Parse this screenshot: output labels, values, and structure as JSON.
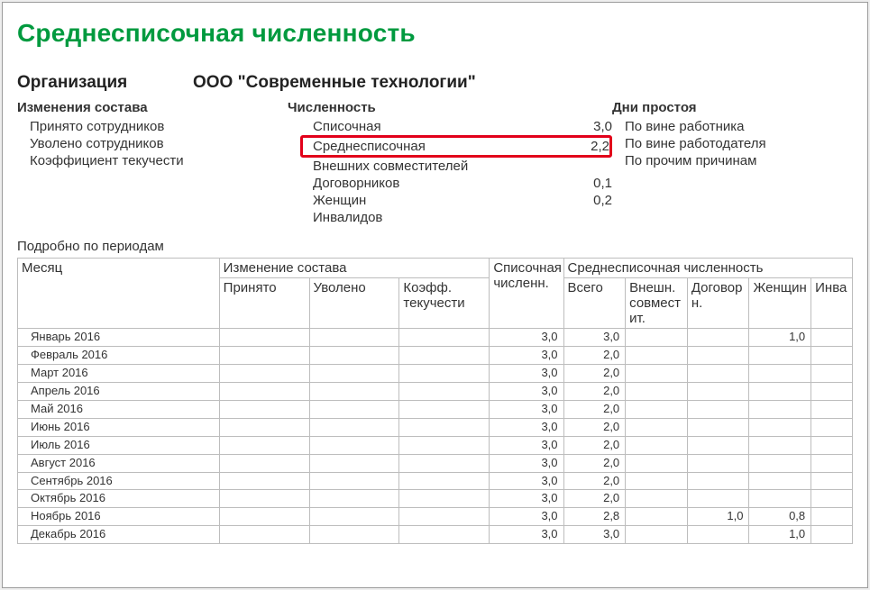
{
  "title": "Среднесписочная численность",
  "org": {
    "label": "Организация",
    "value": "ООО \"Современные технологии\""
  },
  "changes": {
    "header": "Изменения состава",
    "rows": [
      {
        "label": "Принято сотрудников",
        "value": ""
      },
      {
        "label": "Уволено сотрудников",
        "value": ""
      },
      {
        "label": "Коэффициент текучести",
        "value": ""
      }
    ]
  },
  "count": {
    "header": "Численность",
    "rows": [
      {
        "label": "Списочная",
        "value": "3,0",
        "hl": false
      },
      {
        "label": "Среднесписочная",
        "value": "2,2",
        "hl": true
      },
      {
        "label": "Внешних совместителей",
        "value": "",
        "hl": false
      },
      {
        "label": "Договорников",
        "value": "0,1",
        "hl": false
      },
      {
        "label": "Женщин",
        "value": "0,2",
        "hl": false
      },
      {
        "label": "Инвалидов",
        "value": "",
        "hl": false
      }
    ]
  },
  "idle": {
    "header": "Дни простоя",
    "rows": [
      {
        "label": "По вине работника",
        "value": ""
      },
      {
        "label": "По вине работодателя",
        "value": ""
      },
      {
        "label": "По прочим причинам",
        "value": ""
      }
    ]
  },
  "periods_title": "Подробно по периодам",
  "table": {
    "head": {
      "month": "Месяц",
      "changes_group": "Изменение состава",
      "changes": [
        "Принято",
        "Уволено",
        "Коэфф. текучести"
      ],
      "list": "Списочная численн.",
      "avg_group": "Среднесписочная численность",
      "avg": [
        "Всего",
        "Внешн. совмест ит.",
        "Договор н.",
        "Женщин",
        "Инва"
      ]
    },
    "rows": [
      {
        "month": "Январь 2016",
        "hired": "",
        "fired": "",
        "kt": "",
        "list": "3,0",
        "total": "3,0",
        "ext": "",
        "dog": "",
        "women": "1,0",
        "inv": ""
      },
      {
        "month": "Февраль 2016",
        "hired": "",
        "fired": "",
        "kt": "",
        "list": "3,0",
        "total": "2,0",
        "ext": "",
        "dog": "",
        "women": "",
        "inv": ""
      },
      {
        "month": "Март 2016",
        "hired": "",
        "fired": "",
        "kt": "",
        "list": "3,0",
        "total": "2,0",
        "ext": "",
        "dog": "",
        "women": "",
        "inv": ""
      },
      {
        "month": "Апрель 2016",
        "hired": "",
        "fired": "",
        "kt": "",
        "list": "3,0",
        "total": "2,0",
        "ext": "",
        "dog": "",
        "women": "",
        "inv": ""
      },
      {
        "month": "Май 2016",
        "hired": "",
        "fired": "",
        "kt": "",
        "list": "3,0",
        "total": "2,0",
        "ext": "",
        "dog": "",
        "women": "",
        "inv": ""
      },
      {
        "month": "Июнь 2016",
        "hired": "",
        "fired": "",
        "kt": "",
        "list": "3,0",
        "total": "2,0",
        "ext": "",
        "dog": "",
        "women": "",
        "inv": ""
      },
      {
        "month": "Июль 2016",
        "hired": "",
        "fired": "",
        "kt": "",
        "list": "3,0",
        "total": "2,0",
        "ext": "",
        "dog": "",
        "women": "",
        "inv": ""
      },
      {
        "month": "Август 2016",
        "hired": "",
        "fired": "",
        "kt": "",
        "list": "3,0",
        "total": "2,0",
        "ext": "",
        "dog": "",
        "women": "",
        "inv": ""
      },
      {
        "month": "Сентябрь 2016",
        "hired": "",
        "fired": "",
        "kt": "",
        "list": "3,0",
        "total": "2,0",
        "ext": "",
        "dog": "",
        "women": "",
        "inv": ""
      },
      {
        "month": "Октябрь 2016",
        "hired": "",
        "fired": "",
        "kt": "",
        "list": "3,0",
        "total": "2,0",
        "ext": "",
        "dog": "",
        "women": "",
        "inv": ""
      },
      {
        "month": "Ноябрь 2016",
        "hired": "",
        "fired": "",
        "kt": "",
        "list": "3,0",
        "total": "2,8",
        "ext": "",
        "dog": "1,0",
        "women": "0,8",
        "inv": ""
      },
      {
        "month": "Декабрь 2016",
        "hired": "",
        "fired": "",
        "kt": "",
        "list": "3,0",
        "total": "3,0",
        "ext": "",
        "dog": "",
        "women": "1,0",
        "inv": ""
      }
    ]
  }
}
